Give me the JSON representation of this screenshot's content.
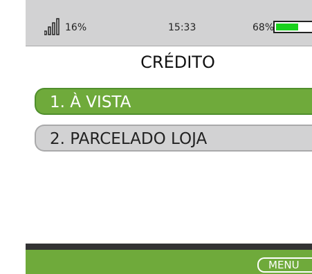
{
  "status": {
    "signal_percent": "16%",
    "time": "15:33",
    "battery_percent": "68%",
    "battery_level": 0.68,
    "signal_icon": "signal-bars-icon",
    "battery_icon": "battery-icon",
    "battery_color": "#19d11d"
  },
  "screen": {
    "title": "CRÉDITO",
    "items": [
      {
        "label": "1. À VISTA",
        "selected": true
      },
      {
        "label": "2. PARCELADO LOJA",
        "selected": false
      }
    ]
  },
  "softkeys": {
    "menu_label": "MENU"
  },
  "colors": {
    "accent_green": "#6faa3b",
    "item_gray": "#d2d2d3",
    "status_bg": "#d2d2d3",
    "bottom_dark": "#333333"
  }
}
